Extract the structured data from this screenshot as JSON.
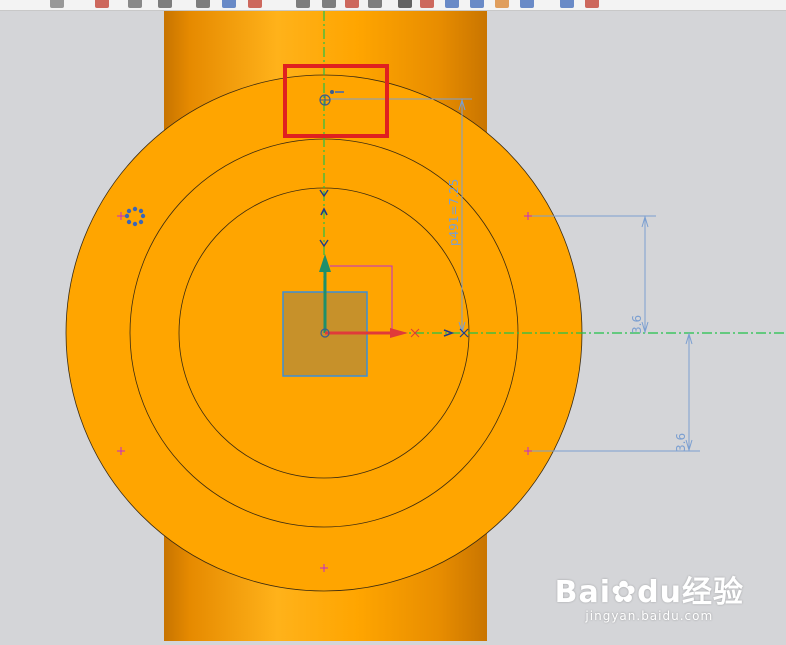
{
  "toolbar": {
    "buttons": [
      {
        "name": "undo-icon",
        "color": "#7a7a7a"
      },
      {
        "name": "sketch-icon",
        "color": "#c0392b"
      },
      {
        "name": "line-icon",
        "color": "#666666"
      },
      {
        "name": "rectangle-icon",
        "color": "#555555"
      },
      {
        "name": "circle-icon",
        "color": "#555555"
      },
      {
        "name": "cube-icon",
        "color": "#3b67b8"
      },
      {
        "name": "trim-icon",
        "color": "#c0392b"
      },
      {
        "name": "arc-icon",
        "color": "#555555"
      },
      {
        "name": "dimension-icon",
        "color": "#555555"
      },
      {
        "name": "constraint-icon",
        "color": "#c0392b"
      },
      {
        "name": "point-icon",
        "color": "#555555"
      },
      {
        "name": "rotate-icon",
        "color": "#333333"
      },
      {
        "name": "mirror-icon",
        "color": "#c0392b"
      },
      {
        "name": "pattern-icon",
        "color": "#3b67b8"
      },
      {
        "name": "view-icon",
        "color": "#3b67b8"
      },
      {
        "name": "render-icon",
        "color": "#d9822b"
      },
      {
        "name": "shade-icon",
        "color": "#3b67b8"
      },
      {
        "name": "cube-view-icon",
        "color": "#3b67b8"
      },
      {
        "name": "finish-sketch-icon",
        "color": "#c0392b"
      }
    ]
  },
  "sketch": {
    "dimensions": {
      "diameter": "p491=7.25",
      "vertical_upper": "3.6",
      "vertical_lower": "3.6"
    }
  },
  "colors": {
    "part": "#ffa500",
    "cylinder_shadow": "#c77400",
    "sketch_line": "#7b9fd1",
    "centerline": "#22c24a",
    "highlight_box": "#e02020",
    "axis_x": "#e03a3a",
    "axis_y": "#1f8f6a",
    "background": "#d4d5d8"
  },
  "watermark": {
    "brand_left": "Bai",
    "brand_right": "du",
    "brand_cn": "经验",
    "url": "jingyan.baidu.com"
  }
}
